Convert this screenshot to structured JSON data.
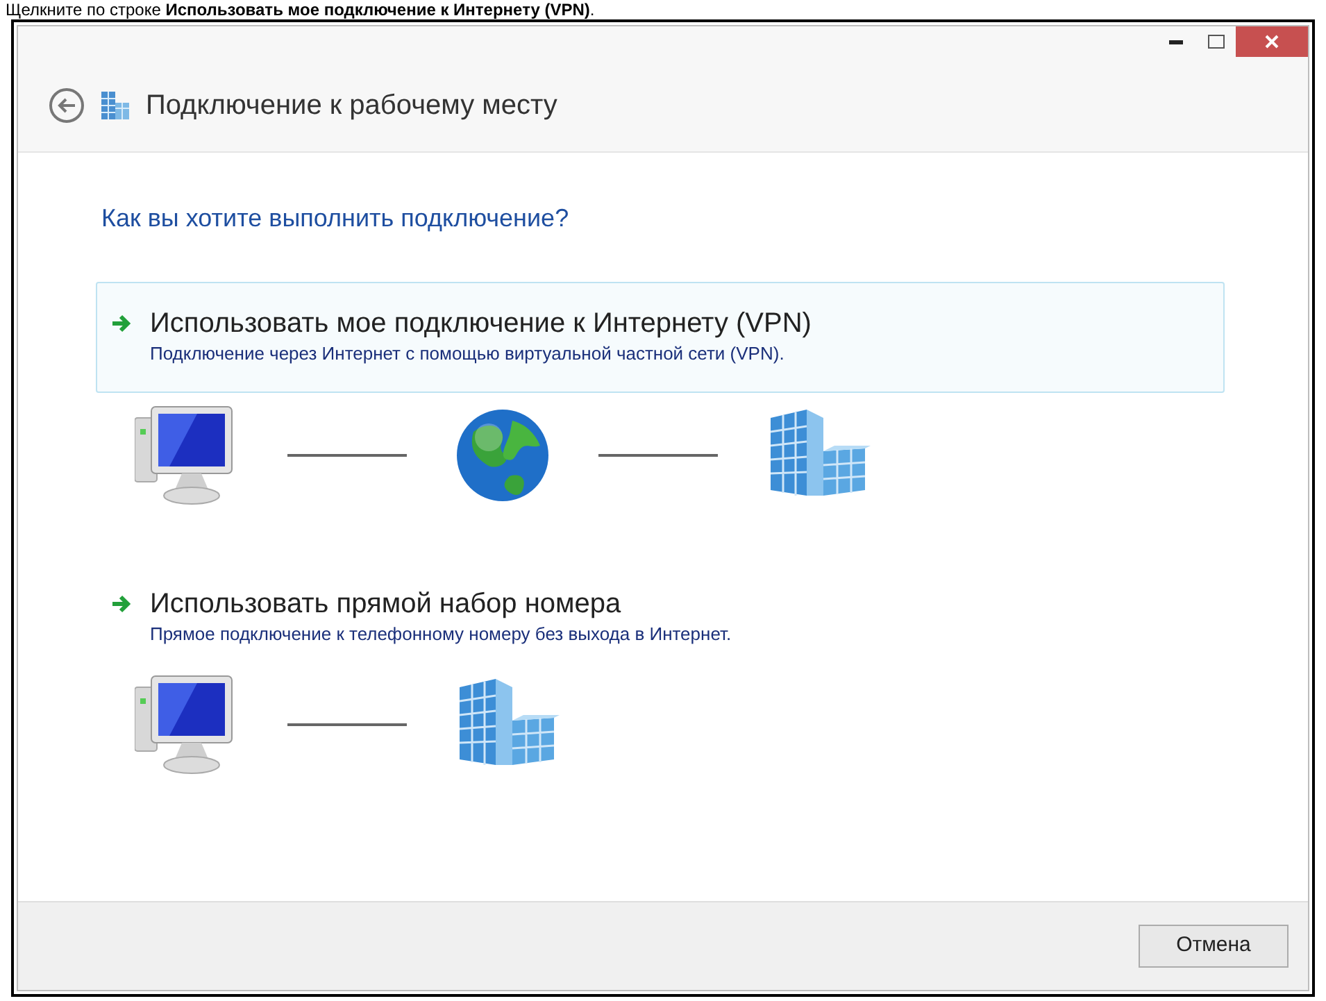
{
  "caption": "Щелкните по строке **Использовать мое подключение к Интернету (VPN)**.",
  "window": {
    "title": "Подключение к рабочему месту"
  },
  "question": "Как вы хотите выполнить подключение?",
  "options": [
    {
      "title": "Использовать мое подключение к Интернету (VPN)",
      "description": "Подключение через Интернет с помощью виртуальной частной сети (VPN).",
      "selected": true,
      "diagram": [
        {
          "kind": "computer"
        },
        {
          "kind": "globe"
        },
        {
          "kind": "building"
        }
      ]
    },
    {
      "title": "Использовать прямой набор номера",
      "description": "Прямое подключение к телефонному номеру без выхода в Интернет.",
      "selected": false,
      "diagram": [
        {
          "kind": "computer"
        },
        {
          "kind": "building"
        }
      ]
    }
  ],
  "buttons": [
    {
      "label": "Отмена"
    }
  ]
}
